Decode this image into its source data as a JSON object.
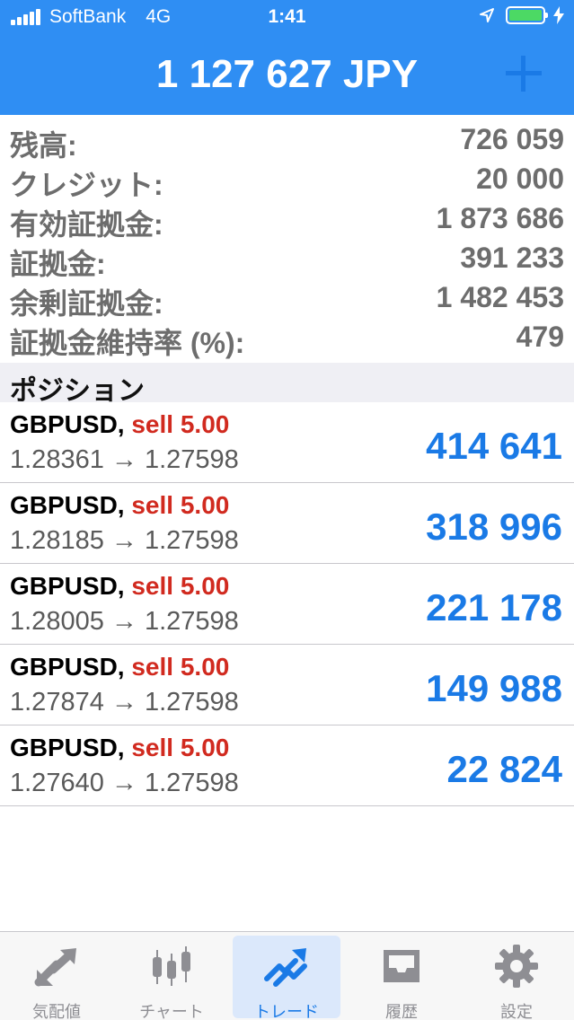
{
  "status_bar": {
    "carrier": "SoftBank",
    "network": "4G",
    "time": "1:41",
    "battery_color": "#4cd964"
  },
  "header": {
    "equity_title": "1 127 627 JPY",
    "add_icon": "plus-icon",
    "background": "#2f8ef3"
  },
  "summary": [
    {
      "label": "残高:",
      "value": "726 059"
    },
    {
      "label": "クレジット:",
      "value": "20 000"
    },
    {
      "label": "有効証拠金:",
      "value": "1 873 686"
    },
    {
      "label": "証拠金:",
      "value": "391 233"
    },
    {
      "label": "余剰証拠金:",
      "value": "1 482 453"
    },
    {
      "label": "証拠金維持率 (%):",
      "value": "479"
    }
  ],
  "positions_header": "ポジション",
  "positions": [
    {
      "symbol": "GBPUSD,",
      "side": "sell 5.00",
      "open": "1.28361",
      "arrow": "→",
      "current": "1.27598",
      "profit": "414 641"
    },
    {
      "symbol": "GBPUSD,",
      "side": "sell 5.00",
      "open": "1.28185",
      "arrow": "→",
      "current": "1.27598",
      "profit": "318 996"
    },
    {
      "symbol": "GBPUSD,",
      "side": "sell 5.00",
      "open": "1.28005",
      "arrow": "→",
      "current": "1.27598",
      "profit": "221 178"
    },
    {
      "symbol": "GBPUSD,",
      "side": "sell 5.00",
      "open": "1.27874",
      "arrow": "→",
      "current": "1.27598",
      "profit": "149 988"
    },
    {
      "symbol": "GBPUSD,",
      "side": "sell 5.00",
      "open": "1.27640",
      "arrow": "→",
      "current": "1.27598",
      "profit": "22 824"
    }
  ],
  "tabbar": [
    {
      "label": "気配値",
      "icon": "quotes-arrows-icon",
      "active": false
    },
    {
      "label": "チャート",
      "icon": "candlestick-chart-icon",
      "active": false
    },
    {
      "label": "トレード",
      "icon": "trade-trend-icon",
      "active": true
    },
    {
      "label": "履歴",
      "icon": "history-inbox-icon",
      "active": false
    },
    {
      "label": "設定",
      "icon": "settings-gear-icon",
      "active": false
    }
  ],
  "colors": {
    "accent": "#1a7ae6",
    "sell": "#d12a1f"
  }
}
